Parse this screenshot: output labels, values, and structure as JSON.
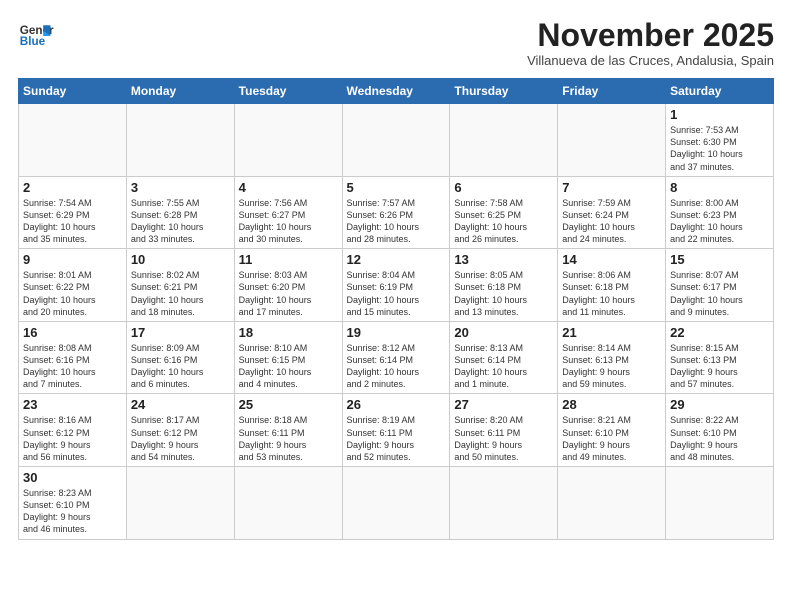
{
  "header": {
    "logo_line1": "General",
    "logo_line2": "Blue",
    "month": "November 2025",
    "location": "Villanueva de las Cruces, Andalusia, Spain"
  },
  "weekdays": [
    "Sunday",
    "Monday",
    "Tuesday",
    "Wednesday",
    "Thursday",
    "Friday",
    "Saturday"
  ],
  "weeks": [
    [
      {
        "day": "",
        "info": ""
      },
      {
        "day": "",
        "info": ""
      },
      {
        "day": "",
        "info": ""
      },
      {
        "day": "",
        "info": ""
      },
      {
        "day": "",
        "info": ""
      },
      {
        "day": "",
        "info": ""
      },
      {
        "day": "1",
        "info": "Sunrise: 7:53 AM\nSunset: 6:30 PM\nDaylight: 10 hours\nand 37 minutes."
      }
    ],
    [
      {
        "day": "2",
        "info": "Sunrise: 7:54 AM\nSunset: 6:29 PM\nDaylight: 10 hours\nand 35 minutes."
      },
      {
        "day": "3",
        "info": "Sunrise: 7:55 AM\nSunset: 6:28 PM\nDaylight: 10 hours\nand 33 minutes."
      },
      {
        "day": "4",
        "info": "Sunrise: 7:56 AM\nSunset: 6:27 PM\nDaylight: 10 hours\nand 30 minutes."
      },
      {
        "day": "5",
        "info": "Sunrise: 7:57 AM\nSunset: 6:26 PM\nDaylight: 10 hours\nand 28 minutes."
      },
      {
        "day": "6",
        "info": "Sunrise: 7:58 AM\nSunset: 6:25 PM\nDaylight: 10 hours\nand 26 minutes."
      },
      {
        "day": "7",
        "info": "Sunrise: 7:59 AM\nSunset: 6:24 PM\nDaylight: 10 hours\nand 24 minutes."
      },
      {
        "day": "8",
        "info": "Sunrise: 8:00 AM\nSunset: 6:23 PM\nDaylight: 10 hours\nand 22 minutes."
      }
    ],
    [
      {
        "day": "9",
        "info": "Sunrise: 8:01 AM\nSunset: 6:22 PM\nDaylight: 10 hours\nand 20 minutes."
      },
      {
        "day": "10",
        "info": "Sunrise: 8:02 AM\nSunset: 6:21 PM\nDaylight: 10 hours\nand 18 minutes."
      },
      {
        "day": "11",
        "info": "Sunrise: 8:03 AM\nSunset: 6:20 PM\nDaylight: 10 hours\nand 17 minutes."
      },
      {
        "day": "12",
        "info": "Sunrise: 8:04 AM\nSunset: 6:19 PM\nDaylight: 10 hours\nand 15 minutes."
      },
      {
        "day": "13",
        "info": "Sunrise: 8:05 AM\nSunset: 6:18 PM\nDaylight: 10 hours\nand 13 minutes."
      },
      {
        "day": "14",
        "info": "Sunrise: 8:06 AM\nSunset: 6:18 PM\nDaylight: 10 hours\nand 11 minutes."
      },
      {
        "day": "15",
        "info": "Sunrise: 8:07 AM\nSunset: 6:17 PM\nDaylight: 10 hours\nand 9 minutes."
      }
    ],
    [
      {
        "day": "16",
        "info": "Sunrise: 8:08 AM\nSunset: 6:16 PM\nDaylight: 10 hours\nand 7 minutes."
      },
      {
        "day": "17",
        "info": "Sunrise: 8:09 AM\nSunset: 6:16 PM\nDaylight: 10 hours\nand 6 minutes."
      },
      {
        "day": "18",
        "info": "Sunrise: 8:10 AM\nSunset: 6:15 PM\nDaylight: 10 hours\nand 4 minutes."
      },
      {
        "day": "19",
        "info": "Sunrise: 8:12 AM\nSunset: 6:14 PM\nDaylight: 10 hours\nand 2 minutes."
      },
      {
        "day": "20",
        "info": "Sunrise: 8:13 AM\nSunset: 6:14 PM\nDaylight: 10 hours\nand 1 minute."
      },
      {
        "day": "21",
        "info": "Sunrise: 8:14 AM\nSunset: 6:13 PM\nDaylight: 9 hours\nand 59 minutes."
      },
      {
        "day": "22",
        "info": "Sunrise: 8:15 AM\nSunset: 6:13 PM\nDaylight: 9 hours\nand 57 minutes."
      }
    ],
    [
      {
        "day": "23",
        "info": "Sunrise: 8:16 AM\nSunset: 6:12 PM\nDaylight: 9 hours\nand 56 minutes."
      },
      {
        "day": "24",
        "info": "Sunrise: 8:17 AM\nSunset: 6:12 PM\nDaylight: 9 hours\nand 54 minutes."
      },
      {
        "day": "25",
        "info": "Sunrise: 8:18 AM\nSunset: 6:11 PM\nDaylight: 9 hours\nand 53 minutes."
      },
      {
        "day": "26",
        "info": "Sunrise: 8:19 AM\nSunset: 6:11 PM\nDaylight: 9 hours\nand 52 minutes."
      },
      {
        "day": "27",
        "info": "Sunrise: 8:20 AM\nSunset: 6:11 PM\nDaylight: 9 hours\nand 50 minutes."
      },
      {
        "day": "28",
        "info": "Sunrise: 8:21 AM\nSunset: 6:10 PM\nDaylight: 9 hours\nand 49 minutes."
      },
      {
        "day": "29",
        "info": "Sunrise: 8:22 AM\nSunset: 6:10 PM\nDaylight: 9 hours\nand 48 minutes."
      }
    ],
    [
      {
        "day": "30",
        "info": "Sunrise: 8:23 AM\nSunset: 6:10 PM\nDaylight: 9 hours\nand 46 minutes."
      },
      {
        "day": "",
        "info": ""
      },
      {
        "day": "",
        "info": ""
      },
      {
        "day": "",
        "info": ""
      },
      {
        "day": "",
        "info": ""
      },
      {
        "day": "",
        "info": ""
      },
      {
        "day": "",
        "info": ""
      }
    ]
  ]
}
